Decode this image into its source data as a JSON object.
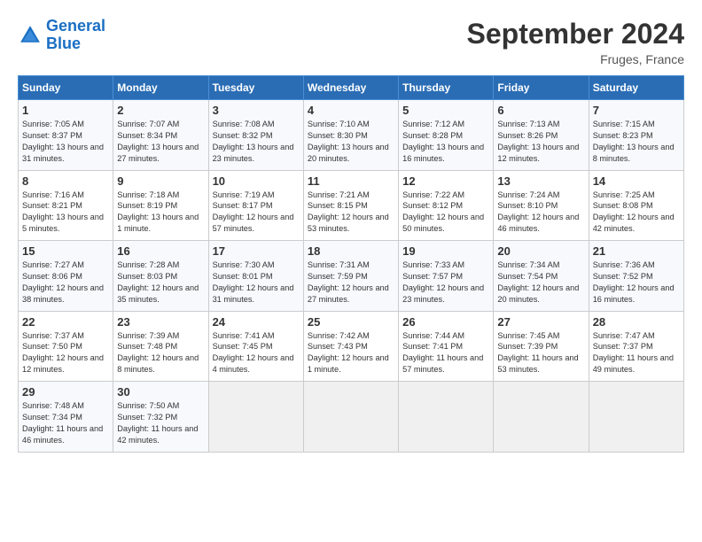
{
  "header": {
    "logo_line1": "General",
    "logo_line2": "Blue",
    "month_year": "September 2024",
    "location": "Fruges, France"
  },
  "days_of_week": [
    "Sunday",
    "Monday",
    "Tuesday",
    "Wednesday",
    "Thursday",
    "Friday",
    "Saturday"
  ],
  "weeks": [
    [
      {
        "day": "1",
        "sunrise": "7:05 AM",
        "sunset": "8:37 PM",
        "daylight": "13 hours and 31 minutes."
      },
      {
        "day": "2",
        "sunrise": "7:07 AM",
        "sunset": "8:34 PM",
        "daylight": "13 hours and 27 minutes."
      },
      {
        "day": "3",
        "sunrise": "7:08 AM",
        "sunset": "8:32 PM",
        "daylight": "13 hours and 23 minutes."
      },
      {
        "day": "4",
        "sunrise": "7:10 AM",
        "sunset": "8:30 PM",
        "daylight": "13 hours and 20 minutes."
      },
      {
        "day": "5",
        "sunrise": "7:12 AM",
        "sunset": "8:28 PM",
        "daylight": "13 hours and 16 minutes."
      },
      {
        "day": "6",
        "sunrise": "7:13 AM",
        "sunset": "8:26 PM",
        "daylight": "13 hours and 12 minutes."
      },
      {
        "day": "7",
        "sunrise": "7:15 AM",
        "sunset": "8:23 PM",
        "daylight": "13 hours and 8 minutes."
      }
    ],
    [
      {
        "day": "8",
        "sunrise": "7:16 AM",
        "sunset": "8:21 PM",
        "daylight": "13 hours and 5 minutes."
      },
      {
        "day": "9",
        "sunrise": "7:18 AM",
        "sunset": "8:19 PM",
        "daylight": "13 hours and 1 minute."
      },
      {
        "day": "10",
        "sunrise": "7:19 AM",
        "sunset": "8:17 PM",
        "daylight": "12 hours and 57 minutes."
      },
      {
        "day": "11",
        "sunrise": "7:21 AM",
        "sunset": "8:15 PM",
        "daylight": "12 hours and 53 minutes."
      },
      {
        "day": "12",
        "sunrise": "7:22 AM",
        "sunset": "8:12 PM",
        "daylight": "12 hours and 50 minutes."
      },
      {
        "day": "13",
        "sunrise": "7:24 AM",
        "sunset": "8:10 PM",
        "daylight": "12 hours and 46 minutes."
      },
      {
        "day": "14",
        "sunrise": "7:25 AM",
        "sunset": "8:08 PM",
        "daylight": "12 hours and 42 minutes."
      }
    ],
    [
      {
        "day": "15",
        "sunrise": "7:27 AM",
        "sunset": "8:06 PM",
        "daylight": "12 hours and 38 minutes."
      },
      {
        "day": "16",
        "sunrise": "7:28 AM",
        "sunset": "8:03 PM",
        "daylight": "12 hours and 35 minutes."
      },
      {
        "day": "17",
        "sunrise": "7:30 AM",
        "sunset": "8:01 PM",
        "daylight": "12 hours and 31 minutes."
      },
      {
        "day": "18",
        "sunrise": "7:31 AM",
        "sunset": "7:59 PM",
        "daylight": "12 hours and 27 minutes."
      },
      {
        "day": "19",
        "sunrise": "7:33 AM",
        "sunset": "7:57 PM",
        "daylight": "12 hours and 23 minutes."
      },
      {
        "day": "20",
        "sunrise": "7:34 AM",
        "sunset": "7:54 PM",
        "daylight": "12 hours and 20 minutes."
      },
      {
        "day": "21",
        "sunrise": "7:36 AM",
        "sunset": "7:52 PM",
        "daylight": "12 hours and 16 minutes."
      }
    ],
    [
      {
        "day": "22",
        "sunrise": "7:37 AM",
        "sunset": "7:50 PM",
        "daylight": "12 hours and 12 minutes."
      },
      {
        "day": "23",
        "sunrise": "7:39 AM",
        "sunset": "7:48 PM",
        "daylight": "12 hours and 8 minutes."
      },
      {
        "day": "24",
        "sunrise": "7:41 AM",
        "sunset": "7:45 PM",
        "daylight": "12 hours and 4 minutes."
      },
      {
        "day": "25",
        "sunrise": "7:42 AM",
        "sunset": "7:43 PM",
        "daylight": "12 hours and 1 minute."
      },
      {
        "day": "26",
        "sunrise": "7:44 AM",
        "sunset": "7:41 PM",
        "daylight": "11 hours and 57 minutes."
      },
      {
        "day": "27",
        "sunrise": "7:45 AM",
        "sunset": "7:39 PM",
        "daylight": "11 hours and 53 minutes."
      },
      {
        "day": "28",
        "sunrise": "7:47 AM",
        "sunset": "7:37 PM",
        "daylight": "11 hours and 49 minutes."
      }
    ],
    [
      {
        "day": "29",
        "sunrise": "7:48 AM",
        "sunset": "7:34 PM",
        "daylight": "11 hours and 46 minutes."
      },
      {
        "day": "30",
        "sunrise": "7:50 AM",
        "sunset": "7:32 PM",
        "daylight": "11 hours and 42 minutes."
      },
      null,
      null,
      null,
      null,
      null
    ]
  ]
}
